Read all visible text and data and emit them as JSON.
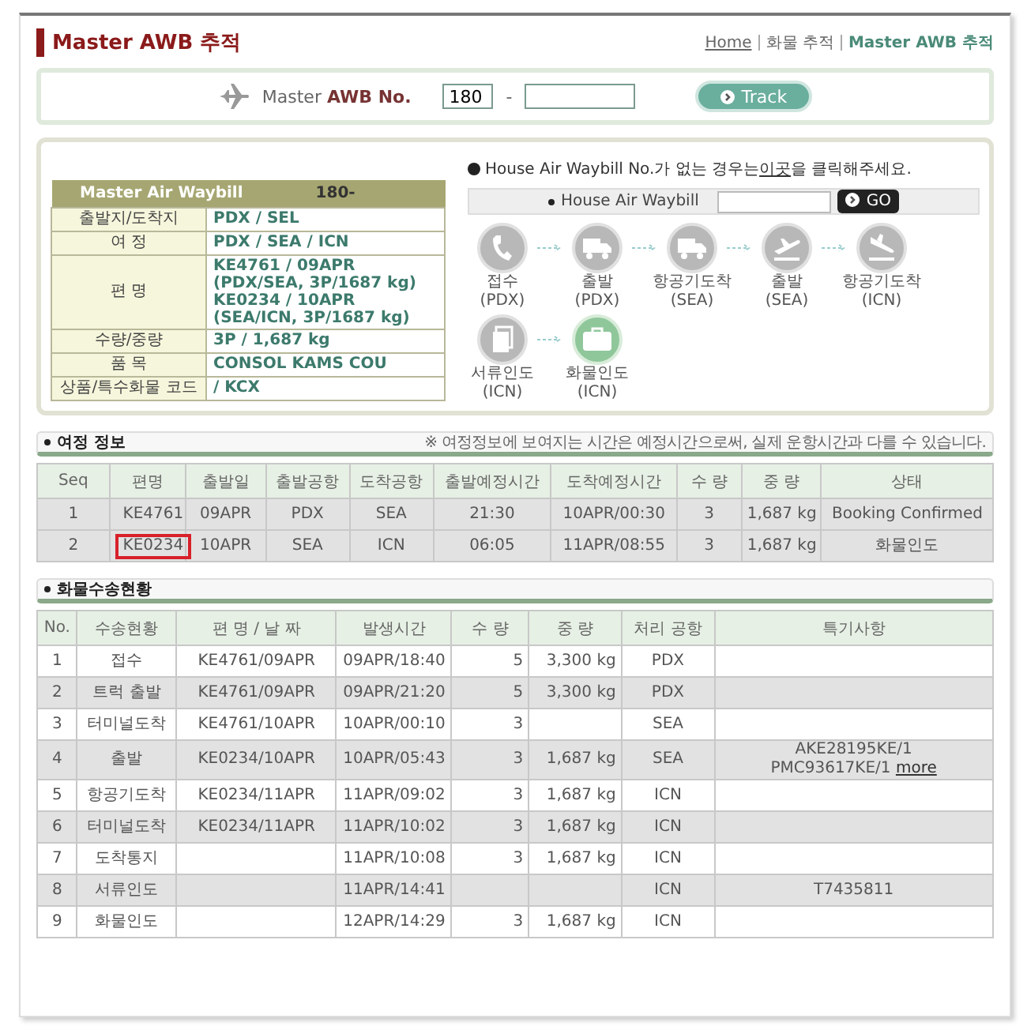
{
  "header": {
    "title": "Master AWB 추적",
    "breadcrumb": [
      {
        "label": "Home",
        "kind": "link"
      },
      {
        "label": "화물 추적",
        "kind": "text"
      },
      {
        "label": "Master AWB 추적",
        "kind": "current"
      }
    ]
  },
  "search": {
    "label_light": "Master",
    "label_bold": "AWB No.",
    "prefix": "180",
    "separator": "-",
    "button": "Track"
  },
  "awb": {
    "title": "Master Air Waybill",
    "number": "180-",
    "rows": [
      {
        "label": "출발지/도착지",
        "lines": [
          "PDX / SEL"
        ]
      },
      {
        "label": "여 정",
        "lines": [
          "PDX / SEA / ICN"
        ]
      },
      {
        "label": "편 명",
        "lines": [
          "KE4761 / 09APR",
          "(PDX/SEA, 3P/1687 kg)",
          "KE0234 / 10APR",
          "(SEA/ICN, 3P/1687 kg)"
        ]
      },
      {
        "label": "수량/중량",
        "lines": [
          "3P / 1,687 kg"
        ]
      },
      {
        "label": "품 목",
        "lines": [
          "CONSOL KAMS COU"
        ]
      },
      {
        "label": "상품/특수화물 코드",
        "lines": [
          "/ KCX"
        ]
      }
    ]
  },
  "house": {
    "notice_before": "House Air Waybill No.가 없는 경우는",
    "notice_link": "이곳",
    "notice_after": "을 클릭해주세요.",
    "field_label": "House Air Waybill",
    "button": "GO"
  },
  "steps": [
    {
      "label": "접수",
      "place": "(PDX)",
      "kind": "phone",
      "current": false
    },
    {
      "label": "출발",
      "place": "(PDX)",
      "kind": "truck",
      "current": false
    },
    {
      "label": "항공기도착",
      "place": "(SEA)",
      "kind": "truck",
      "current": false
    },
    {
      "label": "출발",
      "place": "(SEA)",
      "kind": "takeoff",
      "current": false
    },
    {
      "label": "항공기도착",
      "place": "(ICN)",
      "kind": "landing",
      "current": false
    },
    {
      "label": "서류인도",
      "place": "(ICN)",
      "kind": "document",
      "current": false
    },
    {
      "label": "화물인도",
      "place": "(ICN)",
      "kind": "case",
      "current": true
    }
  ],
  "itinerary": {
    "title": "여정 정보",
    "note": "※ 여정정보에 보여지는 시간은 예정시간으로써, 실제 운항시간과 다를 수 있습니다.",
    "columns": [
      "Seq",
      "편명",
      "출발일",
      "출발공항",
      "도착공항",
      "출발예정시간",
      "도착예정시간",
      "수 량",
      "중 량",
      "상태"
    ],
    "rows": [
      {
        "cells": [
          "1",
          "KE4761",
          "09APR",
          "PDX",
          "SEA",
          "21:30",
          "10APR/00:30",
          "3",
          "1,687 kg",
          "Booking Confirmed"
        ],
        "flagged": false
      },
      {
        "cells": [
          "2",
          "KE0234",
          "10APR",
          "SEA",
          "ICN",
          "06:05",
          "11APR/08:55",
          "3",
          "1,687 kg",
          "화물인도"
        ],
        "flagged": true
      }
    ]
  },
  "cargo": {
    "title": "화물수송현황",
    "columns": [
      "No.",
      "수송현황",
      "편 명 / 날 짜",
      "발생시간",
      "수 량",
      "중 량",
      "처리 공항",
      "특기사항"
    ],
    "rows": [
      {
        "cells": [
          "1",
          "접수",
          "KE4761/09APR",
          "09APR/18:40",
          "5",
          "3,300 kg",
          "PDX"
        ],
        "remarks": []
      },
      {
        "cells": [
          "2",
          "트럭 출발",
          "KE4761/09APR",
          "09APR/21:20",
          "5",
          "3,300 kg",
          "PDX"
        ],
        "remarks": []
      },
      {
        "cells": [
          "3",
          "터미널도착",
          "KE4761/10APR",
          "10APR/00:10",
          "3",
          "",
          "SEA"
        ],
        "remarks": []
      },
      {
        "cells": [
          "4",
          "출발",
          "KE0234/10APR",
          "10APR/05:43",
          "3",
          "1,687 kg",
          "SEA"
        ],
        "remarks": [
          "AKE28195KE/1",
          "PMC93617KE/1"
        ],
        "link": "more"
      },
      {
        "cells": [
          "5",
          "항공기도착",
          "KE0234/11APR",
          "11APR/09:02",
          "3",
          "1,687 kg",
          "ICN"
        ],
        "remarks": []
      },
      {
        "cells": [
          "6",
          "터미널도착",
          "KE0234/11APR",
          "11APR/10:02",
          "3",
          "1,687 kg",
          "ICN"
        ],
        "remarks": []
      },
      {
        "cells": [
          "7",
          "도착통지",
          "",
          "11APR/10:08",
          "3",
          "1,687 kg",
          "ICN"
        ],
        "remarks": []
      },
      {
        "cells": [
          "8",
          "서류인도",
          "",
          "11APR/14:41",
          "",
          "",
          "ICN"
        ],
        "remarks": [
          "T7435811"
        ]
      },
      {
        "cells": [
          "9",
          "화물인도",
          "",
          "12APR/14:29",
          "3",
          "1,687 kg",
          "ICN"
        ],
        "remarks": []
      }
    ]
  }
}
